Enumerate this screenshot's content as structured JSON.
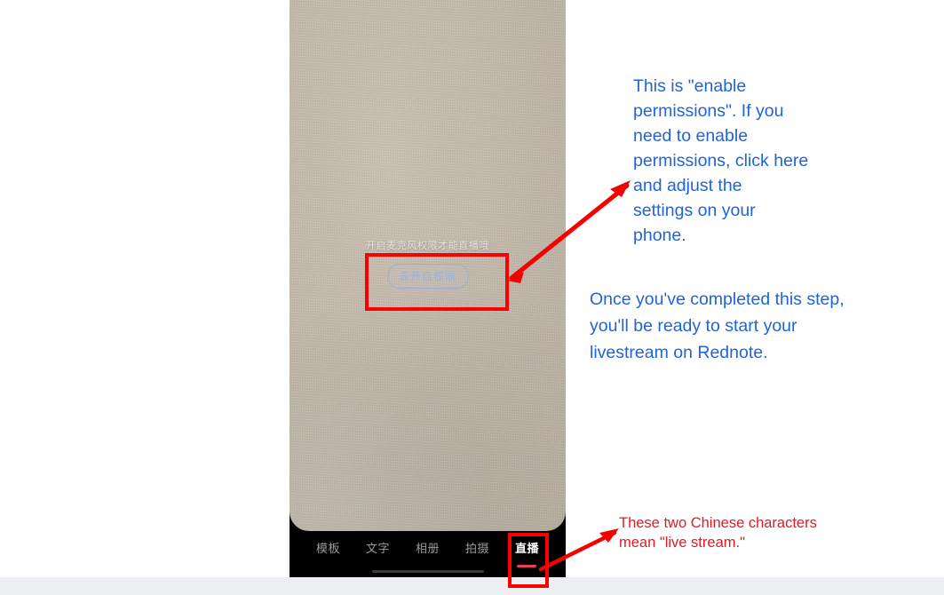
{
  "page": {
    "background_color": "#ffffff",
    "bottom_strip_color": "#eceef2"
  },
  "phone": {
    "camera_background_color": "#c6bcae",
    "permission_hint": "开启麦克风权限才能直播哦",
    "permission_button_label": "去开启权限",
    "tabbar": {
      "background_color": "#000000",
      "active_indicator_color": "#e9415f",
      "tabs": [
        {
          "label": "模板",
          "active": false
        },
        {
          "label": "文字",
          "active": false
        },
        {
          "label": "相册",
          "active": false
        },
        {
          "label": "拍摄",
          "active": false
        },
        {
          "label": "直播",
          "active": true
        }
      ]
    }
  },
  "annotations": {
    "blue_color": "#1f64d8",
    "red_color": "#e01b24",
    "box_color": "#fb0000",
    "blue_note_1": "This is \"enable\npermissions\". If you\nneed to enable\npermissions, click here\n and adjust the\nsettings on your\nphone.",
    "blue_note_2": "Once you've completed this step,\nyou'll be ready to start your\nlivestream on Rednote.",
    "red_note_1": "These two Chinese characters\nmean \"live stream.\""
  }
}
